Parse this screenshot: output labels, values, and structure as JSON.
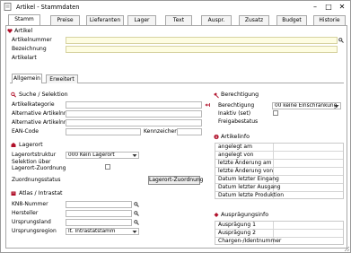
{
  "window": {
    "title": "Artikel - Stammdaten"
  },
  "tabs": [
    "Stamm",
    "Preise",
    "Lieferanten",
    "Lager",
    "Text",
    "Auspr.",
    "Zusatz",
    "Budget",
    "Historie"
  ],
  "artikel": {
    "section": "Artikel",
    "artikelnummer_label": "Artikelnummer",
    "bezeichnung_label": "Bezeichnung",
    "artikelart_label": "Artikelart"
  },
  "subtabs": [
    "Allgemein",
    "Erweitert"
  ],
  "suche": {
    "section": "Suche / Selektion",
    "artikelkategorie": "Artikelkategorie",
    "alt1": "Alternative Artikelnr. 1",
    "alt2": "Alternative Artikelnr. 2",
    "ean": "EAN-Code",
    "kennzeichen": "Kennzeichen"
  },
  "lagerort": {
    "section": "Lagerort",
    "struktur_label": "Lagerortstruktur",
    "struktur_value": "000 Kein Lagerort",
    "selektion_label": "Selektion über",
    "zuordnung_label": "Lagerort-Zuordnung",
    "status_label": "Zuordnungsstatus",
    "button": "Lagerort-Zuordnung"
  },
  "atlas": {
    "section": "Atlas / Intrastat",
    "kn8": "KN8-Nummer",
    "hersteller": "Hersteller",
    "ursprungsland": "Ursprungsland",
    "ursprungsregion": "Ursprungsregion",
    "region_value": "lt. Intrastatstamm"
  },
  "berechtigung": {
    "section": "Berechtigung",
    "berechtigung_label": "Berechtigung",
    "berechtigung_value": "00 keine Einschränkung",
    "inaktiv_label": "Inaktiv (set)",
    "freigabe_label": "Freigabestatus"
  },
  "artikelinfo": {
    "section": "Artikelinfo",
    "rows": [
      "angelegt am",
      "angelegt von",
      "letzte Änderung am",
      "letzte Änderung von",
      "Datum letzter Eingang",
      "Datum letzter Ausgang",
      "Datum letzte Produktion"
    ]
  },
  "auspraegung": {
    "section": "Ausprägungsinfo",
    "rows": [
      "Ausprägung 1",
      "Ausprägung 2",
      "Chargen-/Identnummer"
    ]
  },
  "colors": {
    "accent_red": "#b0102a",
    "field_yellow": "#fefde2"
  }
}
